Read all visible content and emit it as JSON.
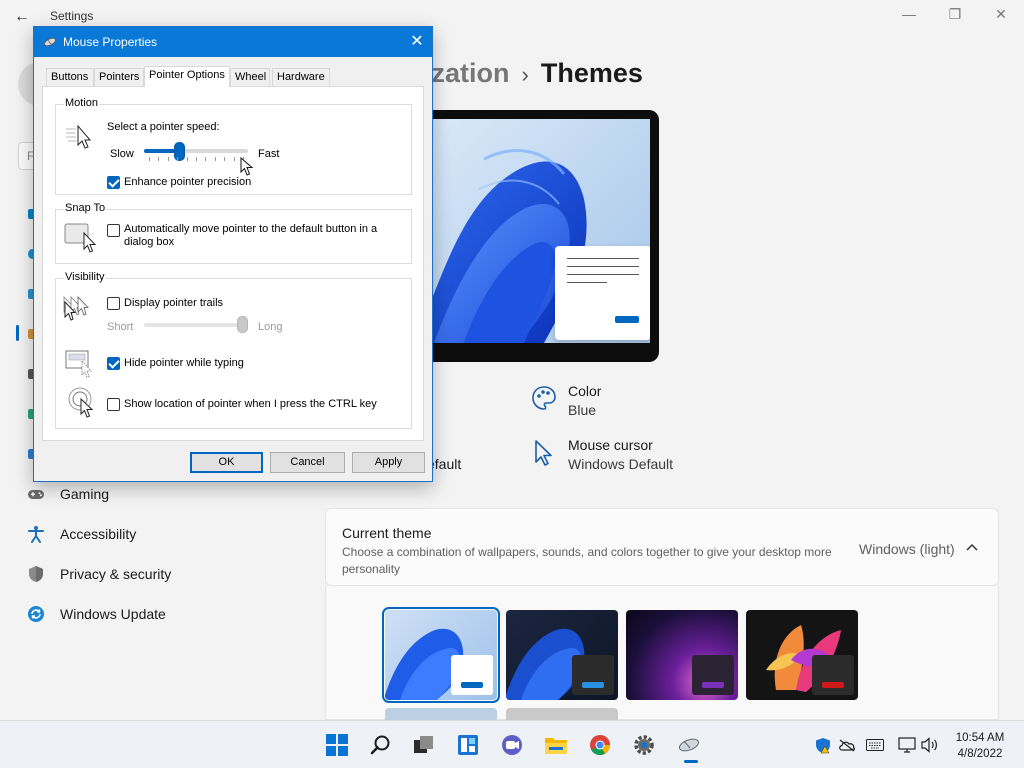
{
  "settings": {
    "app_title": "Settings",
    "breadcrumb": {
      "parent": "ization",
      "separator": "›",
      "current": "Themes"
    },
    "search_placeholder_visible": "F",
    "nav": [
      {
        "label": "Gaming",
        "icon": "gamepad-icon"
      },
      {
        "label": "Accessibility",
        "icon": "accessibility-icon"
      },
      {
        "label": "Privacy & security",
        "icon": "shield-icon"
      },
      {
        "label": "Windows Update",
        "icon": "sync-icon"
      }
    ],
    "properties": {
      "color": {
        "title": "Color",
        "value": "Blue",
        "icon": "palette-icon"
      },
      "cursor": {
        "title": "Mouse cursor",
        "value": "Windows Default",
        "icon": "cursor-icon"
      },
      "partial_left_text": "efault"
    },
    "current_theme": {
      "title": "Current theme",
      "description": "Choose a combination of wallpapers, sounds, and colors together to give your desktop more personality",
      "value": "Windows (light)"
    },
    "accent_color": "#0067c0"
  },
  "dialog": {
    "title": "Mouse Properties",
    "tabs": [
      "Buttons",
      "Pointers",
      "Pointer Options",
      "Wheel",
      "Hardware"
    ],
    "active_tab": "Pointer Options",
    "motion": {
      "group_label": "Motion",
      "speed_label": "Select a pointer speed:",
      "slow_label": "Slow",
      "fast_label": "Fast",
      "speed_fraction": 0.32,
      "enhance_precision_label": "Enhance pointer precision",
      "enhance_precision_checked": true
    },
    "snap_to": {
      "group_label": "Snap To",
      "auto_move_label": "Automatically move pointer to the default button in a dialog box",
      "auto_move_checked": false
    },
    "visibility": {
      "group_label": "Visibility",
      "trails_label": "Display pointer trails",
      "trails_checked": false,
      "short_label": "Short",
      "long_label": "Long",
      "trail_fraction": 1.0,
      "hide_typing_label": "Hide pointer while typing",
      "hide_typing_checked": true,
      "show_ctrl_label": "Show location of pointer when I press the CTRL key",
      "show_ctrl_checked": false
    },
    "buttons": {
      "ok": "OK",
      "cancel": "Cancel",
      "apply": "Apply"
    }
  },
  "taskbar": {
    "pinned": [
      "windows-start-icon",
      "search-icon",
      "task-view-icon",
      "widgets-icon",
      "teams-chat-icon",
      "file-explorer-icon",
      "chrome-icon",
      "settings-gear-icon",
      "mouse-properties-icon"
    ],
    "tray": [
      "security-shield-icon",
      "onedrive-icon",
      "keyboard-icon",
      "network-icon",
      "volume-icon"
    ],
    "time": "10:54 AM",
    "date": "4/8/2022"
  }
}
